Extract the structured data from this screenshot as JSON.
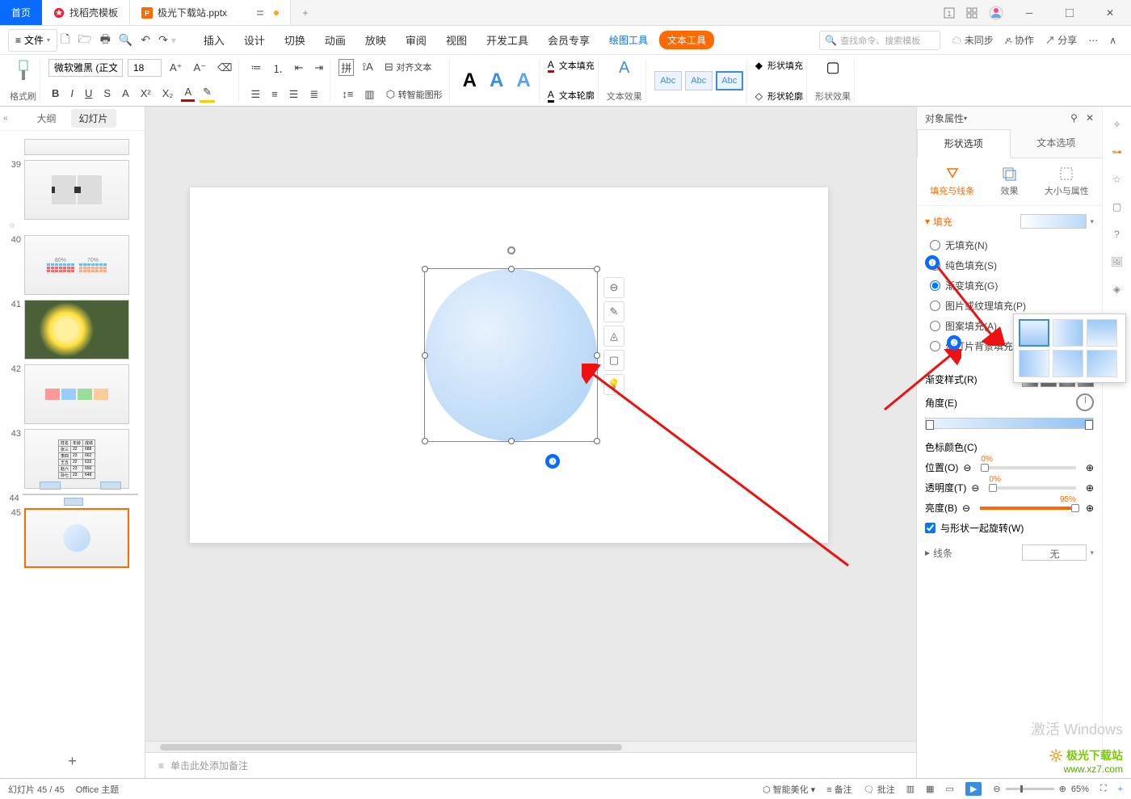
{
  "titlebar": {
    "home": "首页",
    "template": "找稻壳模板",
    "file": "极光下载站.pptx"
  },
  "menubar": {
    "file_label": "文件",
    "items": [
      "插入",
      "设计",
      "切换",
      "动画",
      "放映",
      "审阅",
      "视图",
      "开发工具",
      "会员专享"
    ],
    "draw_tool": "绘图工具",
    "text_tool": "文本工具",
    "search_ph": "查找命令、搜索模板",
    "unsync": "未同步",
    "collab": "协作",
    "share": "分享"
  },
  "ribbon": {
    "format_painter": "格式刷",
    "font_name": "微软雅黑 (正文)",
    "font_size": "18",
    "align_text": "对齐文本",
    "smart_graphic": "转智能图形",
    "text_fill": "文本填充",
    "text_outline": "文本轮廓",
    "text_effect": "文本效果",
    "abc": "Abc",
    "shape_fill": "形状填充",
    "shape_outline": "形状轮廓",
    "shape_effect": "形状效果"
  },
  "outline": {
    "tab_outline": "大纲",
    "tab_slides": "幻灯片",
    "nums": [
      "39",
      "40",
      "41",
      "42",
      "43",
      "44",
      "45"
    ]
  },
  "canvas": {
    "notes_ph": "单击此处添加备注"
  },
  "props": {
    "panel_title": "对象属性",
    "shape_options": "形状选项",
    "text_options": "文本选项",
    "tab_fill_line": "填充与线条",
    "tab_effect": "效果",
    "tab_size": "大小与属性",
    "section_fill": "填充",
    "no_fill": "无填充(N)",
    "solid_fill": "纯色填充(S)",
    "gradient_fill": "渐变填充(G)",
    "picture_fill": "图片或纹理填充(P)",
    "pattern_fill": "图案填充(A)",
    "slide_bg_fill": "幻灯片背景填充(B)",
    "gradient_style": "渐变样式(R)",
    "angle": "角度(E)",
    "stop_color": "色标颜色(C)",
    "position": "位置(O)",
    "transparency": "透明度(T)",
    "brightness": "亮度(B)",
    "rotate_with": "与形状一起旋转(W)",
    "section_line": "线条",
    "line_none": "无",
    "pos_val": "0%",
    "trans_val": "0%",
    "bright_val": "95%"
  },
  "status": {
    "slide_info": "幻灯片 45 / 45",
    "theme": "Office 主题",
    "smart_beautify": "智能美化",
    "notes": "备注",
    "comments": "批注",
    "zoom": "65%",
    "activate": "激活 Windows"
  },
  "watermark": {
    "site_cn": "极光下载站",
    "site_url": "www.xz7.com"
  }
}
